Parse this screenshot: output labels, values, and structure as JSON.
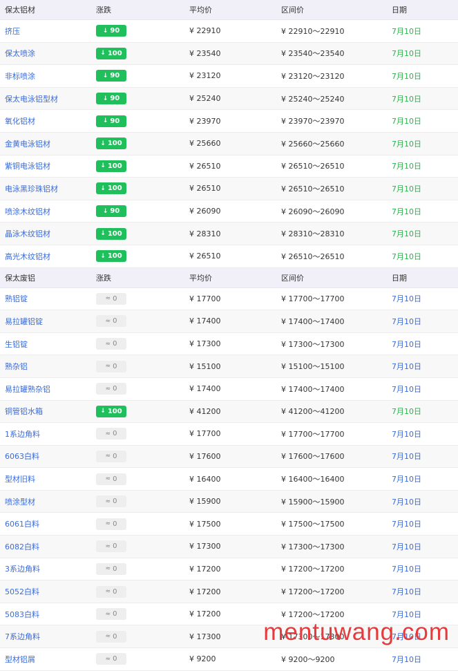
{
  "colors": {
    "down": "#1fbf5c",
    "accent_blue": "#3b6bd6",
    "date_green": "#2bb24c",
    "header_bg": "#f1f0f9"
  },
  "sections": [
    {
      "header": {
        "name": "保太铝材",
        "change": "涨跌",
        "avg": "平均价",
        "range": "区间价",
        "date": "日期"
      },
      "rows": [
        {
          "name": "挤压",
          "change": "90",
          "dir": "down",
          "avg": "¥  22910",
          "range": "¥  22910～22910",
          "date": "7月10日"
        },
        {
          "name": "保太喷涂",
          "change": "100",
          "dir": "down",
          "avg": "¥  23540",
          "range": "¥  23540～23540",
          "date": "7月10日"
        },
        {
          "name": "非标喷涂",
          "change": "90",
          "dir": "down",
          "avg": "¥  23120",
          "range": "¥  23120～23120",
          "date": "7月10日"
        },
        {
          "name": "保太电泳铝型材",
          "change": "90",
          "dir": "down",
          "avg": "¥  25240",
          "range": "¥  25240～25240",
          "date": "7月10日"
        },
        {
          "name": "氧化铝材",
          "change": "90",
          "dir": "down",
          "avg": "¥  23970",
          "range": "¥  23970～23970",
          "date": "7月10日"
        },
        {
          "name": "金黄电泳铝材",
          "change": "100",
          "dir": "down",
          "avg": "¥  25660",
          "range": "¥  25660～25660",
          "date": "7月10日"
        },
        {
          "name": "紫铜电泳铝材",
          "change": "100",
          "dir": "down",
          "avg": "¥  26510",
          "range": "¥  26510～26510",
          "date": "7月10日"
        },
        {
          "name": "电泳黑珍珠铝材",
          "change": "100",
          "dir": "down",
          "avg": "¥  26510",
          "range": "¥  26510～26510",
          "date": "7月10日"
        },
        {
          "name": "喷涂木纹铝材",
          "change": "90",
          "dir": "down",
          "avg": "¥  26090",
          "range": "¥  26090～26090",
          "date": "7月10日"
        },
        {
          "name": "晶泳木纹铝材",
          "change": "100",
          "dir": "down",
          "avg": "¥  28310",
          "range": "¥  28310～28310",
          "date": "7月10日"
        },
        {
          "name": "高光木纹铝材",
          "change": "100",
          "dir": "down",
          "avg": "¥  26510",
          "range": "¥  26510～26510",
          "date": "7月10日"
        }
      ]
    },
    {
      "header": {
        "name": "保太废铝",
        "change": "涨跌",
        "avg": "平均价",
        "range": "区间价",
        "date": "日期"
      },
      "rows": [
        {
          "name": "熟铝锭",
          "change": "0",
          "dir": "flat",
          "avg": "¥  17700",
          "range": "¥  17700～17700",
          "date": "7月10日"
        },
        {
          "name": "易拉罐铝锭",
          "change": "0",
          "dir": "flat",
          "avg": "¥  17400",
          "range": "¥  17400～17400",
          "date": "7月10日"
        },
        {
          "name": "生铝锭",
          "change": "0",
          "dir": "flat",
          "avg": "¥  17300",
          "range": "¥  17300～17300",
          "date": "7月10日"
        },
        {
          "name": "熟杂铝",
          "change": "0",
          "dir": "flat",
          "avg": "¥  15100",
          "range": "¥  15100～15100",
          "date": "7月10日"
        },
        {
          "name": "易拉罐熟杂铝",
          "change": "0",
          "dir": "flat",
          "avg": "¥  17400",
          "range": "¥  17400～17400",
          "date": "7月10日"
        },
        {
          "name": "铜管铝水箱",
          "change": "100",
          "dir": "down",
          "avg": "¥  41200",
          "range": "¥  41200～41200",
          "date": "7月10日"
        },
        {
          "name": "1系边角料",
          "change": "0",
          "dir": "flat",
          "avg": "¥  17700",
          "range": "¥  17700～17700",
          "date": "7月10日"
        },
        {
          "name": "6063白料",
          "change": "0",
          "dir": "flat",
          "avg": "¥  17600",
          "range": "¥  17600～17600",
          "date": "7月10日"
        },
        {
          "name": "型材旧料",
          "change": "0",
          "dir": "flat",
          "avg": "¥  16400",
          "range": "¥  16400～16400",
          "date": "7月10日"
        },
        {
          "name": "喷涂型材",
          "change": "0",
          "dir": "flat",
          "avg": "¥  15900",
          "range": "¥  15900～15900",
          "date": "7月10日"
        },
        {
          "name": "6061白料",
          "change": "0",
          "dir": "flat",
          "avg": "¥  17500",
          "range": "¥  17500～17500",
          "date": "7月10日"
        },
        {
          "name": "6082白料",
          "change": "0",
          "dir": "flat",
          "avg": "¥  17300",
          "range": "¥  17300～17300",
          "date": "7月10日"
        },
        {
          "name": "3系边角料",
          "change": "0",
          "dir": "flat",
          "avg": "¥  17200",
          "range": "¥  17200～17200",
          "date": "7月10日"
        },
        {
          "name": "5052白料",
          "change": "0",
          "dir": "flat",
          "avg": "¥  17200",
          "range": "¥  17200～17200",
          "date": "7月10日"
        },
        {
          "name": "5083白料",
          "change": "0",
          "dir": "flat",
          "avg": "¥  17200",
          "range": "¥  17200～17200",
          "date": "7月10日"
        },
        {
          "name": "7系边角料",
          "change": "0",
          "dir": "flat",
          "avg": "¥  17300",
          "range": "¥  17300～17300",
          "date": "7月10日"
        },
        {
          "name": "型材铝屑",
          "change": "0",
          "dir": "flat",
          "avg": "¥  9200",
          "range": "¥  9200～9200",
          "date": "7月10日"
        }
      ]
    }
  ],
  "watermark": "mentuwang.com"
}
